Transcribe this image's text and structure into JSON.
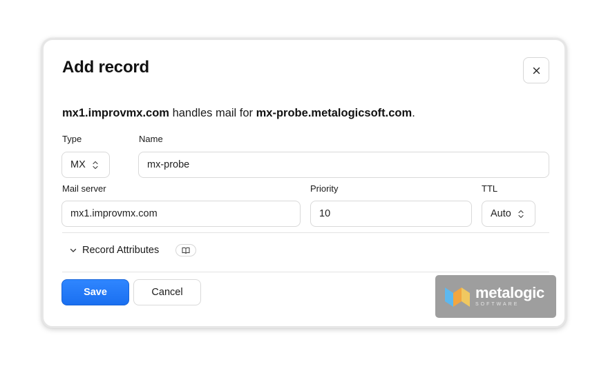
{
  "dialog": {
    "title": "Add record",
    "close_label": "×"
  },
  "description": {
    "server": "mx1.improvmx.com",
    "middle": " handles mail for ",
    "domain": "mx-probe.metalogicsoft.com",
    "end": "."
  },
  "form": {
    "type": {
      "label": "Type",
      "value": "MX"
    },
    "name": {
      "label": "Name",
      "value": "mx-probe"
    },
    "mail_server": {
      "label": "Mail server",
      "value": "mx1.improvmx.com"
    },
    "priority": {
      "label": "Priority",
      "value": "10"
    },
    "ttl": {
      "label": "TTL",
      "value": "Auto"
    }
  },
  "record_attributes": {
    "label": "Record Attributes"
  },
  "actions": {
    "save_label": "Save",
    "cancel_label": "Cancel"
  },
  "watermark": {
    "name": "metalogic",
    "sub": "SOFTWARE"
  },
  "colors": {
    "accent": "#1a6ff0",
    "border": "#d9d9d9"
  },
  "icons": {
    "close": "close-icon",
    "updown": "chevron-up-down-icon",
    "expand": "chevron-down-icon",
    "docs": "book-icon",
    "logo": "metalogic-logo-icon"
  }
}
